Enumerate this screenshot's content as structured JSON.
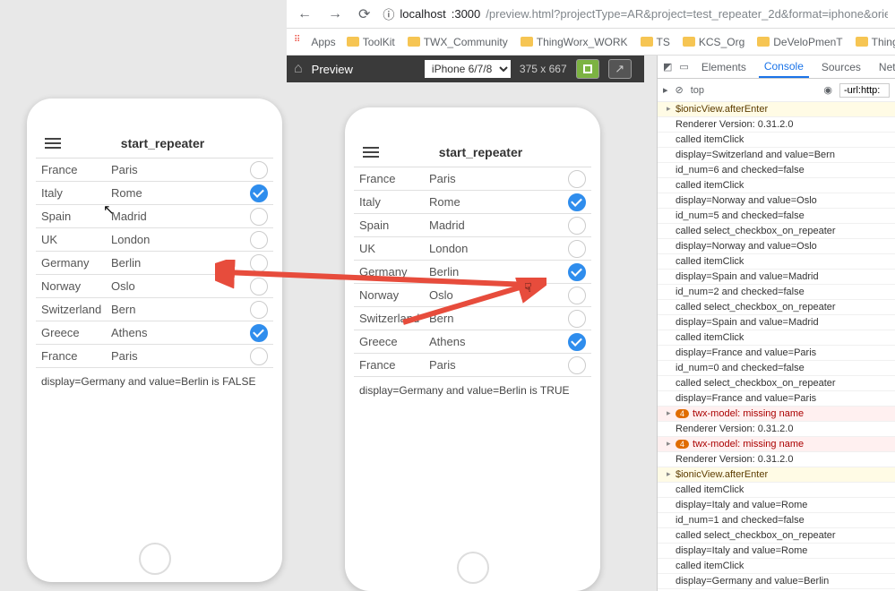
{
  "browser": {
    "url_host": "localhost",
    "url_port": ":3000",
    "url_path": "/preview.html?projectType=AR&project=test_repeater_2d&format=iphone&orientation"
  },
  "bookmarks": {
    "apps": "Apps",
    "items": [
      "ToolKit",
      "TWX_Community",
      "ThingWorx_WORK",
      "TS",
      "KCS_Org",
      "DeVeloPmenT",
      "ThingWorxKE"
    ]
  },
  "preview_bar": {
    "label": "Preview",
    "device": "iPhone 6/7/8",
    "dims": "375 x 667"
  },
  "app": {
    "title": "start_repeater",
    "rows": [
      {
        "country": "France",
        "city": "Paris",
        "checked": false
      },
      {
        "country": "Italy",
        "city": "Rome",
        "checked": true
      },
      {
        "country": "Spain",
        "city": "Madrid",
        "checked": false
      },
      {
        "country": "UK",
        "city": "London",
        "checked": false
      },
      {
        "country": "Germany",
        "city": "Berlin",
        "checked": false
      },
      {
        "country": "Norway",
        "city": "Oslo",
        "checked": false
      },
      {
        "country": "Switzerland",
        "city": "Bern",
        "checked": false
      },
      {
        "country": "Greece",
        "city": "Athens",
        "checked": true
      },
      {
        "country": "France",
        "city": "Paris",
        "checked": false
      }
    ],
    "status_left": "display=Germany and value=Berlin is FALSE",
    "status_right": "display=Germany and value=Berlin is TRUE",
    "right_checked_extra_index": 4
  },
  "devtools": {
    "tabs": [
      "Elements",
      "Console",
      "Sources",
      "Netw"
    ],
    "active_tab": "Console",
    "context": "top",
    "filter_value": "-url:http:",
    "logs": [
      {
        "t": "warn",
        "expand": true,
        "msg": "$ionicView.afterEnter"
      },
      {
        "t": "",
        "msg": "Renderer Version: 0.31.2.0"
      },
      {
        "t": "",
        "msg": "called itemClick"
      },
      {
        "t": "",
        "msg": "display=Switzerland  and value=Bern"
      },
      {
        "t": "",
        "msg": "id_num=6  and checked=false"
      },
      {
        "t": "",
        "msg": "called itemClick"
      },
      {
        "t": "",
        "msg": "display=Norway  and value=Oslo"
      },
      {
        "t": "",
        "msg": "id_num=5  and checked=false"
      },
      {
        "t": "",
        "msg": "called select_checkbox_on_repeater"
      },
      {
        "t": "",
        "msg": "display=Norway  and value=Oslo"
      },
      {
        "t": "",
        "msg": "called itemClick"
      },
      {
        "t": "",
        "msg": "display=Spain  and value=Madrid"
      },
      {
        "t": "",
        "msg": "id_num=2  and checked=false"
      },
      {
        "t": "",
        "msg": "called select_checkbox_on_repeater"
      },
      {
        "t": "",
        "msg": "display=Spain  and value=Madrid"
      },
      {
        "t": "",
        "msg": "called itemClick"
      },
      {
        "t": "",
        "msg": "display=France  and value=Paris"
      },
      {
        "t": "",
        "msg": "id_num=0  and checked=false"
      },
      {
        "t": "",
        "msg": "called select_checkbox_on_repeater"
      },
      {
        "t": "",
        "msg": "display=France  and value=Paris"
      },
      {
        "t": "err",
        "expand": true,
        "count": "4",
        "msg": "twx-model: missing name"
      },
      {
        "t": "",
        "msg": "Renderer Version: 0.31.2.0"
      },
      {
        "t": "err",
        "expand": true,
        "count": "4",
        "msg": "twx-model: missing name"
      },
      {
        "t": "",
        "msg": "Renderer Version: 0.31.2.0"
      },
      {
        "t": "warn",
        "expand": true,
        "msg": "$ionicView.afterEnter"
      },
      {
        "t": "",
        "msg": "called itemClick"
      },
      {
        "t": "",
        "msg": "display=Italy  and value=Rome"
      },
      {
        "t": "",
        "msg": "id_num=1  and checked=false"
      },
      {
        "t": "",
        "msg": "called select_checkbox_on_repeater"
      },
      {
        "t": "",
        "msg": "display=Italy  and value=Rome"
      },
      {
        "t": "",
        "msg": "called itemClick"
      },
      {
        "t": "",
        "msg": "display=Germany  and value=Berlin"
      }
    ]
  }
}
